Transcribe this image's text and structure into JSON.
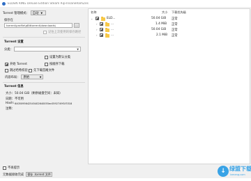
{
  "window": {
    "title": "ELDEN RING Deluxe Edition Steam Rip-InsaneRamZes"
  },
  "left": {
    "torrent_mode_label": "Torrent 管理模式：",
    "torrent_mode_value": "自动",
    "save_to_header": "保存在",
    "save_path_value": "torrent\\profile\\qBittorrent\\downloads\\",
    "browse_label": "...",
    "last_used_path_label": "记住上次使用的保存路径",
    "torrent_settings_header": "Torrent 设置",
    "category_label": "分类：",
    "category_value": "",
    "default_category_label": "设置为默认分类",
    "start_torrent_label": "开始 Torrent",
    "sequential_label": "按顺序下载",
    "skip_hash_label": "跳过哈希校验",
    "first_last_label": "先下载首尾文件",
    "content_layout_label": "内容布局：",
    "content_layout_value": "原始",
    "info_header": "Torrent 信息",
    "size_label": "大小：",
    "size_value": "50.04 GiB（剩余磁盘空间：未知）",
    "date_label": "日期：",
    "date_value": "不可用",
    "hash_label": "Hash:",
    "hash_value": "6405095642545402640055ec0592749f1f3318",
    "comment_label": "注释："
  },
  "tree": {
    "col_name": "名称",
    "col_size": "大小",
    "col_priority": "下载优先级",
    "rows": [
      {
        "name": "ELD...",
        "size": "50.04 GiB",
        "priority": "正常"
      },
      {
        "name": "...",
        "size": "1.4 MiB",
        "priority": "正常"
      },
      {
        "name": "...",
        "size": "50.04 GiB",
        "priority": "正常"
      },
      {
        "name": "...",
        "size": "2.1 MiB",
        "priority": "正常"
      }
    ]
  },
  "bottom": {
    "no_show_again_label": "不再提示",
    "metadata_label": "元数据接收完成",
    "save_torrent_button": "保存 .torrent 文件"
  },
  "watermark": {
    "text": "绿盟下载",
    "sub": "lvmeng.com"
  },
  "colors": {
    "accent": "#39a3e6",
    "folder": "#f7c948"
  }
}
